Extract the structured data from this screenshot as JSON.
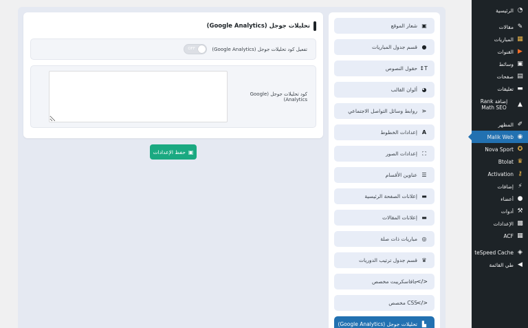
{
  "admin_menu": {
    "items": [
      {
        "label": "الرئيسية",
        "icon": "dashboard-icon"
      },
      {
        "label": "مقالات",
        "icon": "pin-icon"
      },
      {
        "label": "المباريات",
        "icon": "matches-icon"
      },
      {
        "label": "القنوات",
        "icon": "play-icon"
      },
      {
        "label": "وسائط",
        "icon": "media-icon"
      },
      {
        "label": "صفحات",
        "icon": "pages-icon"
      },
      {
        "label": "تعليقات",
        "icon": "comments-icon"
      },
      {
        "label": "إضافة Rank Math SEO",
        "icon": "rankmath-icon"
      },
      {
        "label": "المظهر",
        "icon": "brush-icon"
      },
      {
        "label": "Malik Web",
        "icon": "malik-icon"
      },
      {
        "label": "Nova Sport",
        "icon": "nova-icon"
      },
      {
        "label": "Btolat",
        "icon": "trophy-icon"
      },
      {
        "label": "Activation",
        "icon": "key-icon"
      },
      {
        "label": "إضافات",
        "icon": "plugins-icon"
      },
      {
        "label": "أعضاء",
        "icon": "users-icon"
      },
      {
        "label": "أدوات",
        "icon": "tools-icon"
      },
      {
        "label": "الإعدادات",
        "icon": "settings-icon"
      },
      {
        "label": "ACF",
        "icon": "acf-icon"
      },
      {
        "label": "LiteSpeed Cache",
        "icon": "litespeed-icon"
      },
      {
        "label": "طي القائمة",
        "icon": "collapse-icon"
      }
    ],
    "active": "Malik Web"
  },
  "settings_nav": {
    "items": [
      {
        "label": "شعار الموقع",
        "icon": "image-icon"
      },
      {
        "label": "قسم جدول المباريات",
        "icon": "circle-icon"
      },
      {
        "label": "حقول النصوص",
        "icon": "text-height-icon"
      },
      {
        "label": "ألوان القالب",
        "icon": "palette-icon"
      },
      {
        "label": "روابط وسائل التواصل الاجتماعي",
        "icon": "share-icon"
      },
      {
        "label": "إعدادات الخطوط",
        "icon": "font-icon"
      },
      {
        "label": "إعدادات الصور",
        "icon": "expand-icon"
      },
      {
        "label": "عناوين الأقسام",
        "icon": "list-icon"
      },
      {
        "label": "إعلانات الصفحة الرئيسية",
        "icon": "ad-icon"
      },
      {
        "label": "إعلانات المقالات",
        "icon": "ad-icon"
      },
      {
        "label": "مباريات ذات صلة",
        "icon": "futbol-icon"
      },
      {
        "label": "قسم جدول ترتيب الدوريات",
        "icon": "trophy-icon"
      },
      {
        "label": "جافاسكريبت مخصص",
        "icon": "code-icon"
      },
      {
        "label": "CSS مخصص",
        "icon": "code-icon"
      },
      {
        "label": "تحليلات جوجل (Google Analytics)",
        "icon": "chart-icon"
      }
    ],
    "active_index": 14
  },
  "panel": {
    "title": "تحليلات جوجل (Google Analytics)",
    "enable_label": "تفعيل كود تحليلات جوجل (Google Analytics)",
    "toggle_state": "OFF",
    "code_label": "كود تحليلات جوجل (Google Analytics)",
    "code_value": ""
  },
  "save_button": {
    "label": "حفظ الإعدادات"
  },
  "colors": {
    "admin_bg": "#1d2327",
    "accent": "#2271b1",
    "save_green": "#1aa981",
    "page_bg": "#e5e9f2"
  }
}
